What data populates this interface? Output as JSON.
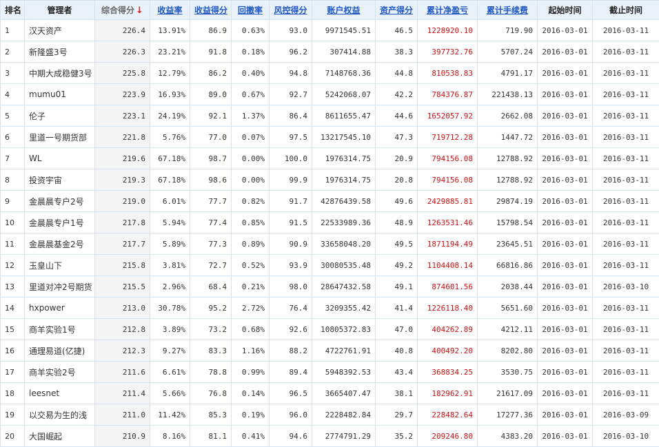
{
  "headers": {
    "rank": "排名",
    "manager": "管理者",
    "score": "综合得分",
    "sort_arrow": "↓",
    "return_rate": "收益率",
    "return_score": "收益得分",
    "drawdown": "回撤率",
    "risk_score": "风控得分",
    "equity": "账户权益",
    "asset_score": "资产得分",
    "cum_pnl": "累计净盈亏",
    "cum_fee": "累计手续费",
    "start": "起始时间",
    "end": "截止时间"
  },
  "rows": [
    {
      "rank": "1",
      "manager": "汉天资产",
      "score": "226.4",
      "return_rate": "13.91%",
      "return_score": "86.9",
      "drawdown": "0.63%",
      "risk_score": "93.0",
      "equity": "9971545.51",
      "asset_score": "46.5",
      "cum_pnl": "1228920.10",
      "cum_fee": "719.90",
      "start": "2016-03-01",
      "end": "2016-03-11"
    },
    {
      "rank": "2",
      "manager": "新隆盛3号",
      "score": "226.3",
      "return_rate": "23.21%",
      "return_score": "91.8",
      "drawdown": "0.18%",
      "risk_score": "96.2",
      "equity": "307414.88",
      "asset_score": "38.3",
      "cum_pnl": "397732.76",
      "cum_fee": "5707.24",
      "start": "2016-03-01",
      "end": "2016-03-11"
    },
    {
      "rank": "3",
      "manager": "中期大成稳健3号",
      "score": "225.8",
      "return_rate": "12.79%",
      "return_score": "86.2",
      "drawdown": "0.40%",
      "risk_score": "94.8",
      "equity": "7148768.36",
      "asset_score": "44.8",
      "cum_pnl": "810538.83",
      "cum_fee": "4791.17",
      "start": "2016-03-01",
      "end": "2016-03-11"
    },
    {
      "rank": "4",
      "manager": "mumu01",
      "score": "223.9",
      "return_rate": "16.93%",
      "return_score": "89.0",
      "drawdown": "0.67%",
      "risk_score": "92.7",
      "equity": "5242068.07",
      "asset_score": "42.2",
      "cum_pnl": "784376.87",
      "cum_fee": "221438.13",
      "start": "2016-03-01",
      "end": "2016-03-11"
    },
    {
      "rank": "5",
      "manager": "伦子",
      "score": "223.1",
      "return_rate": "24.19%",
      "return_score": "92.1",
      "drawdown": "1.37%",
      "risk_score": "86.4",
      "equity": "8611655.47",
      "asset_score": "44.6",
      "cum_pnl": "1652057.92",
      "cum_fee": "2662.08",
      "start": "2016-03-01",
      "end": "2016-03-11"
    },
    {
      "rank": "6",
      "manager": "里道一号期货部",
      "score": "221.8",
      "return_rate": "5.76%",
      "return_score": "77.0",
      "drawdown": "0.07%",
      "risk_score": "97.5",
      "equity": "13217545.10",
      "asset_score": "47.3",
      "cum_pnl": "719712.28",
      "cum_fee": "1447.72",
      "start": "2016-03-01",
      "end": "2016-03-11"
    },
    {
      "rank": "7",
      "manager": "WL",
      "score": "219.6",
      "return_rate": "67.18%",
      "return_score": "98.7",
      "drawdown": "0.00%",
      "risk_score": "100.0",
      "equity": "1976314.75",
      "asset_score": "20.9",
      "cum_pnl": "794156.08",
      "cum_fee": "12788.92",
      "start": "2016-03-01",
      "end": "2016-03-11"
    },
    {
      "rank": "8",
      "manager": "投资宇宙",
      "score": "219.3",
      "return_rate": "67.18%",
      "return_score": "98.6",
      "drawdown": "0.00%",
      "risk_score": "99.9",
      "equity": "1976314.75",
      "asset_score": "20.8",
      "cum_pnl": "794156.08",
      "cum_fee": "12788.92",
      "start": "2016-03-01",
      "end": "2016-03-11"
    },
    {
      "rank": "9",
      "manager": "金晨晨专户2号",
      "score": "219.0",
      "return_rate": "6.01%",
      "return_score": "77.7",
      "drawdown": "0.82%",
      "risk_score": "91.7",
      "equity": "42876439.58",
      "asset_score": "49.6",
      "cum_pnl": "2429885.81",
      "cum_fee": "29874.19",
      "start": "2016-03-01",
      "end": "2016-03-11"
    },
    {
      "rank": "10",
      "manager": "金晨晨专户1号",
      "score": "217.8",
      "return_rate": "5.94%",
      "return_score": "77.4",
      "drawdown": "0.85%",
      "risk_score": "91.5",
      "equity": "22533989.36",
      "asset_score": "48.9",
      "cum_pnl": "1263531.46",
      "cum_fee": "15798.54",
      "start": "2016-03-01",
      "end": "2016-03-11"
    },
    {
      "rank": "11",
      "manager": "金晨晨基金2号",
      "score": "217.7",
      "return_rate": "5.89%",
      "return_score": "77.3",
      "drawdown": "0.89%",
      "risk_score": "90.9",
      "equity": "33658048.20",
      "asset_score": "49.5",
      "cum_pnl": "1871194.49",
      "cum_fee": "23645.51",
      "start": "2016-03-01",
      "end": "2016-03-11"
    },
    {
      "rank": "12",
      "manager": "玉皇山下",
      "score": "215.8",
      "return_rate": "3.81%",
      "return_score": "72.7",
      "drawdown": "0.52%",
      "risk_score": "93.9",
      "equity": "30080535.48",
      "asset_score": "49.2",
      "cum_pnl": "1104408.14",
      "cum_fee": "66816.86",
      "start": "2016-03-01",
      "end": "2016-03-11"
    },
    {
      "rank": "13",
      "manager": "里道对冲2号期货",
      "score": "215.5",
      "return_rate": "2.96%",
      "return_score": "68.4",
      "drawdown": "0.21%",
      "risk_score": "98.0",
      "equity": "28647432.58",
      "asset_score": "49.1",
      "cum_pnl": "874601.56",
      "cum_fee": "2038.44",
      "start": "2016-03-01",
      "end": "2016-03-10"
    },
    {
      "rank": "14",
      "manager": "hxpower",
      "score": "213.0",
      "return_rate": "30.78%",
      "return_score": "95.2",
      "drawdown": "2.72%",
      "risk_score": "76.4",
      "equity": "3209355.42",
      "asset_score": "41.4",
      "cum_pnl": "1226118.40",
      "cum_fee": "5651.60",
      "start": "2016-03-01",
      "end": "2016-03-11"
    },
    {
      "rank": "15",
      "manager": "商羊实验1号",
      "score": "212.8",
      "return_rate": "3.89%",
      "return_score": "73.2",
      "drawdown": "0.68%",
      "risk_score": "92.6",
      "equity": "10805372.83",
      "asset_score": "47.0",
      "cum_pnl": "404262.89",
      "cum_fee": "4212.11",
      "start": "2016-03-01",
      "end": "2016-03-11"
    },
    {
      "rank": "16",
      "manager": "通理易道(亿捷)",
      "score": "212.3",
      "return_rate": "9.27%",
      "return_score": "83.3",
      "drawdown": "1.16%",
      "risk_score": "88.2",
      "equity": "4722761.91",
      "asset_score": "40.8",
      "cum_pnl": "400492.20",
      "cum_fee": "8202.80",
      "start": "2016-03-01",
      "end": "2016-03-11"
    },
    {
      "rank": "17",
      "manager": "商羊实验2号",
      "score": "211.6",
      "return_rate": "6.61%",
      "return_score": "78.8",
      "drawdown": "0.99%",
      "risk_score": "89.4",
      "equity": "5948392.53",
      "asset_score": "43.4",
      "cum_pnl": "368834.25",
      "cum_fee": "3530.75",
      "start": "2016-03-01",
      "end": "2016-03-11"
    },
    {
      "rank": "18",
      "manager": "leesnet",
      "score": "211.4",
      "return_rate": "5.66%",
      "return_score": "76.8",
      "drawdown": "0.14%",
      "risk_score": "96.5",
      "equity": "3665407.47",
      "asset_score": "38.1",
      "cum_pnl": "182962.91",
      "cum_fee": "21617.09",
      "start": "2016-03-01",
      "end": "2016-03-11"
    },
    {
      "rank": "19",
      "manager": "以交易为生的浅",
      "score": "211.0",
      "return_rate": "11.42%",
      "return_score": "85.3",
      "drawdown": "0.19%",
      "risk_score": "96.0",
      "equity": "2228482.84",
      "asset_score": "29.7",
      "cum_pnl": "228482.64",
      "cum_fee": "17277.36",
      "start": "2016-03-01",
      "end": "2016-03-09"
    },
    {
      "rank": "20",
      "manager": "大国崛起",
      "score": "210.9",
      "return_rate": "8.16%",
      "return_score": "81.1",
      "drawdown": "0.41%",
      "risk_score": "94.6",
      "equity": "2774791.29",
      "asset_score": "35.2",
      "cum_pnl": "209246.80",
      "cum_fee": "4383.20",
      "start": "2016-03-01",
      "end": "2016-03-10"
    }
  ]
}
